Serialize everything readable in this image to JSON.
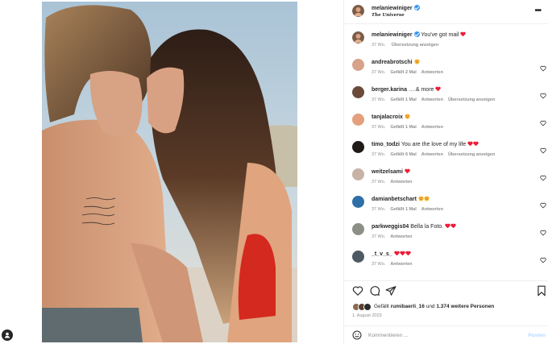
{
  "post": {
    "author": "melaniewiniger",
    "location": "The Universe",
    "caption_author": "melaniewiniger",
    "caption": "You've got mail",
    "caption_age": "37 Wo.",
    "caption_translate": "Übersetzung anzeigen",
    "more_icon": "more-horizontal-icon"
  },
  "comments": [
    {
      "user": "andreabrotschi",
      "text": "",
      "emoji": [
        "heart-eyes"
      ],
      "age": "37 Wo.",
      "likes": "Gefällt 2 Mal",
      "reply": "Antworten",
      "translate": ""
    },
    {
      "user": "berger.karina",
      "text": "….& more",
      "emoji": [
        "red-heart"
      ],
      "age": "37 Wo.",
      "likes": "Gefällt 1 Mal",
      "reply": "Antworten",
      "translate": "Übersetzung anzeigen"
    },
    {
      "user": "tanjalacroix",
      "text": "",
      "emoji": [
        "heart-eyes"
      ],
      "age": "37 Wo.",
      "likes": "Gefällt 1 Mal",
      "reply": "Antworten",
      "translate": ""
    },
    {
      "user": "timo_todzi",
      "text": "You are the love of my life",
      "emoji": [
        "red-heart",
        "red-heart"
      ],
      "age": "37 Wo.",
      "likes": "Gefällt 6 Mal",
      "reply": "Antworten",
      "translate": "Übersetzung anzeigen"
    },
    {
      "user": "weitzelsami",
      "text": "",
      "emoji": [
        "red-heart"
      ],
      "age": "37 Wo.",
      "likes": "",
      "reply": "Antworten",
      "translate": ""
    },
    {
      "user": "damianbetschart",
      "text": "",
      "emoji": [
        "heart-eyes",
        "heart-eyes"
      ],
      "age": "37 Wo.",
      "likes": "Gefällt 1 Mal",
      "reply": "Antworten",
      "translate": ""
    },
    {
      "user": "parkweggis04",
      "text": "Bella la Foto.",
      "emoji": [
        "red-heart",
        "red-heart"
      ],
      "age": "37 Wo.",
      "likes": "",
      "reply": "Antworten",
      "translate": ""
    },
    {
      "user": "_t_v_s_",
      "text": "",
      "emoji": [
        "red-heart",
        "red-heart",
        "red-heart"
      ],
      "age": "37 Wo.",
      "likes": "",
      "reply": "Antworten",
      "translate": ""
    }
  ],
  "footer": {
    "liked_prefix": "Gefällt",
    "liked_user": "rumibaerli_16",
    "liked_mid": "und",
    "liked_count": "1.374 weitere Personen",
    "date": "1. August 2023",
    "comment_placeholder": "Kommentieren ...",
    "post_label": "Posten"
  },
  "colors": {
    "accent": "#3897f0",
    "heart": "#ed1c35",
    "muted": "#8e8e8e",
    "post_disabled": "#b3dbff"
  }
}
